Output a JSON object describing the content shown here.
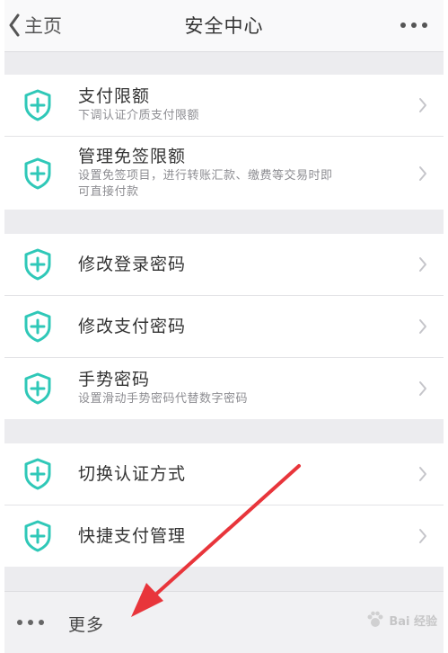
{
  "navbar": {
    "back_label": "主页",
    "title": "安全中心"
  },
  "groups": [
    {
      "items": [
        {
          "title": "支付限额",
          "subtitle": "下调认证介质支付限额"
        },
        {
          "title": "管理免签限额",
          "subtitle_line1": "设置免签项目，进行转账汇款、缴费等交易时即",
          "subtitle_line2": "可直接付款"
        }
      ]
    },
    {
      "items": [
        {
          "title": "修改登录密码"
        },
        {
          "title": "修改支付密码"
        },
        {
          "title": "手势密码",
          "subtitle": "设置滑动手势密码代替数字密码"
        }
      ]
    },
    {
      "items": [
        {
          "title": "切换认证方式"
        },
        {
          "title": "快捷支付管理"
        }
      ]
    }
  ],
  "footer": {
    "more_label": "更多"
  },
  "watermark": {
    "text": "Bai 经验"
  },
  "colors": {
    "accent": "#2fc8b8",
    "annotation_arrow": "#e8353b",
    "background": "#ececef"
  },
  "icons": {
    "back": "chevron-left-icon",
    "more": "ellipsis-icon",
    "item": "shield-plus-icon",
    "row": "chevron-right-icon"
  }
}
